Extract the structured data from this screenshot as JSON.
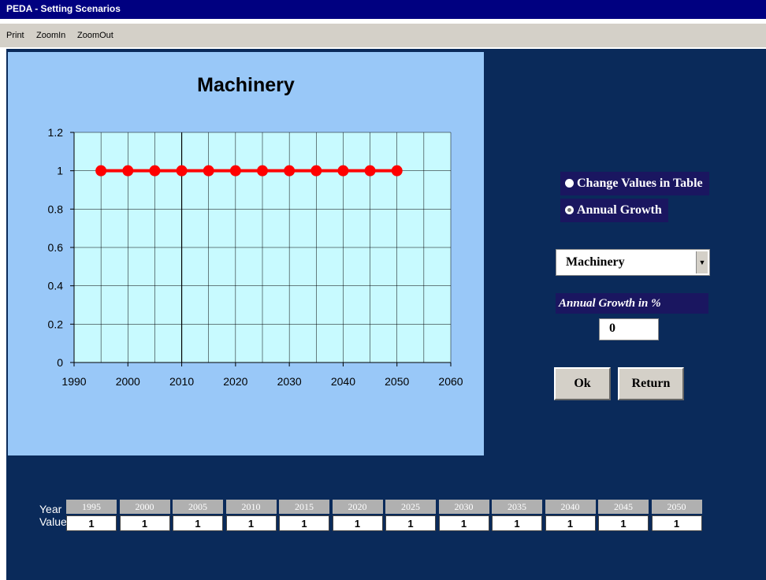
{
  "window": {
    "title": "PEDA - Setting Scenarios"
  },
  "menu": {
    "items": [
      "Print",
      "ZoomIn",
      "ZoomOut"
    ]
  },
  "chart_data": {
    "type": "line",
    "title": "Machinery",
    "x": [
      1995,
      2000,
      2005,
      2010,
      2015,
      2020,
      2025,
      2030,
      2035,
      2040,
      2045,
      2050
    ],
    "series": [
      {
        "values": [
          1,
          1,
          1,
          1,
          1,
          1,
          1,
          1,
          1,
          1,
          1,
          1
        ],
        "color": "#ff0000"
      }
    ],
    "xlim": [
      1990,
      2060
    ],
    "ylim": [
      0,
      1.2
    ],
    "xticks": [
      "1990",
      "2000",
      "2010",
      "2020",
      "2030",
      "2040",
      "2050",
      "2060"
    ],
    "yticks": [
      "0",
      "0.2",
      "0.4",
      "0.6",
      "0.8",
      "1",
      "1.2"
    ],
    "grid": true,
    "xlabel": "",
    "ylabel": ""
  },
  "options": {
    "change_values_label": "Change Values in Table",
    "annual_growth_label": "Annual Growth",
    "selected": "annual_growth"
  },
  "sector_select": {
    "value": "Machinery"
  },
  "growth": {
    "label": "Annual Growth in %",
    "value": "0"
  },
  "buttons": {
    "ok": "Ok",
    "return": "Return"
  },
  "table": {
    "year_label": "Year",
    "value_label": "Value",
    "years": [
      "1995",
      "2000",
      "2005",
      "2010",
      "2015",
      "2020",
      "2025",
      "2030",
      "2035",
      "2040",
      "2045",
      "2050"
    ],
    "values": [
      "1",
      "1",
      "1",
      "1",
      "1",
      "1",
      "1",
      "1",
      "1",
      "1",
      "1",
      "1"
    ]
  },
  "colors": {
    "titlebar": "#000080",
    "background": "#0a2a5a",
    "chart_panel": "#99c8f8",
    "plot_area": "#c8faff",
    "accent": "#1a1660",
    "series": "#ff0000"
  }
}
